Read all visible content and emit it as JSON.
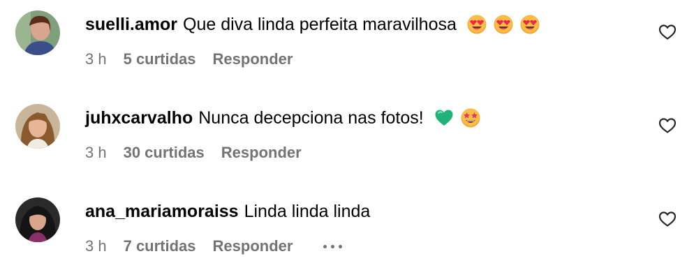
{
  "comments": [
    {
      "username": "suelli.amor",
      "text": "Que diva linda perfeita maravilhosa",
      "emojis": [
        "heart-eyes-emoji",
        "heart-eyes-emoji",
        "heart-eyes-emoji"
      ],
      "time": "3 h",
      "likes": "5 curtidas",
      "reply": "Responder"
    },
    {
      "username": "juhxcarvalho",
      "text": "Nunca decepciona nas fotos!",
      "emojis": [
        "green-heart-emoji",
        "star-struck-emoji"
      ],
      "time": "3 h",
      "likes": "30 curtidas",
      "reply": "Responder"
    },
    {
      "username": "ana_mariamoraiss",
      "text": "Linda linda linda",
      "emojis": [],
      "time": "3 h",
      "likes": "7 curtidas",
      "reply": "Responder",
      "more_options": "more-options-icon"
    }
  ],
  "colors": {
    "secondary_text": "#737373",
    "primary_text": "#000000",
    "background": "#ffffff"
  }
}
